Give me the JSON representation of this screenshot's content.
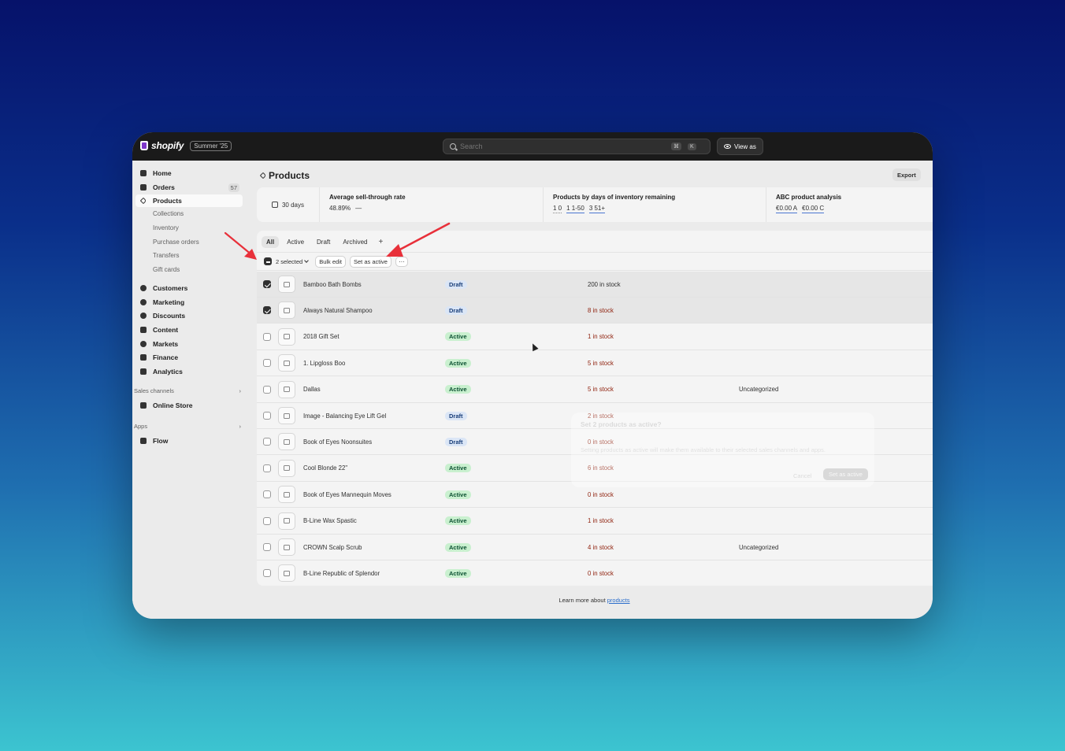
{
  "topbar": {
    "logo": "shopify",
    "edition": "Summer '25",
    "search_placeholder": "Search",
    "shortcut_1": "⌘",
    "shortcut_2": "K",
    "view_as": "View as"
  },
  "sidebar": {
    "home": "Home",
    "orders": "Orders",
    "orders_count": "57",
    "products": "Products",
    "collections": "Collections",
    "inventory": "Inventory",
    "purchase_orders": "Purchase orders",
    "transfers": "Transfers",
    "gift_cards": "Gift cards",
    "customers": "Customers",
    "marketing": "Marketing",
    "discounts": "Discounts",
    "content": "Content",
    "markets": "Markets",
    "finance": "Finance",
    "analytics": "Analytics",
    "sales_channels": "Sales channels",
    "online_store": "Online Store",
    "apps": "Apps",
    "flow": "Flow"
  },
  "page": {
    "title": "Products",
    "export": "Export"
  },
  "stats": {
    "range": "30 days",
    "sell_through_title": "Average sell-through rate",
    "sell_through_value": "48.89%",
    "sell_through_trend": "—",
    "inventory_title": "Products by days of inventory remaining",
    "inv_a": "1 0",
    "inv_b": "1 1-50",
    "inv_c": "3 51+",
    "abc_title": "ABC product analysis",
    "abc_a": "€0.00 A",
    "abc_b": "€0.00 C"
  },
  "tabs": {
    "all": "All",
    "active": "Active",
    "draft": "Draft",
    "archived": "Archived",
    "add": "+"
  },
  "bulk": {
    "selected": "2 selected",
    "bulk_edit": "Bulk edit",
    "set_active": "Set as active",
    "more": "···"
  },
  "products": [
    {
      "name": "Bamboo Bath Bombs",
      "status": "Draft",
      "stock": "200 in stock",
      "type": "",
      "selected": true
    },
    {
      "name": "Always Natural Shampoo",
      "status": "Draft",
      "stock": "8 in stock",
      "type": "",
      "selected": true
    },
    {
      "name": "2018 Gift Set",
      "status": "Active",
      "stock": "1 in stock",
      "type": "",
      "selected": false
    },
    {
      "name": "1. Lipgloss Boo",
      "status": "Active",
      "stock": "5 in stock",
      "type": "",
      "selected": false
    },
    {
      "name": "Dallas",
      "status": "Active",
      "stock": "5 in stock",
      "type": "Uncategorized",
      "selected": false
    },
    {
      "name": "Image - Balancing Eye Lift Gel",
      "status": "Draft",
      "stock": "2 in stock",
      "type": "",
      "selected": false
    },
    {
      "name": "Book of Eyes Noonsuites",
      "status": "Draft",
      "stock": "0 in stock",
      "type": "",
      "selected": false
    },
    {
      "name": "Cool Blonde 22\"",
      "status": "Active",
      "stock": "6 in stock",
      "type": "",
      "selected": false
    },
    {
      "name": "Book of Eyes Mannequin Moves",
      "status": "Active",
      "stock": "0 in stock",
      "type": "",
      "selected": false
    },
    {
      "name": "B-Line Wax Spastic",
      "status": "Active",
      "stock": "1 in stock",
      "type": "",
      "selected": false
    },
    {
      "name": "CROWN Scalp Scrub",
      "status": "Active",
      "stock": "4 in stock",
      "type": "Uncategorized",
      "selected": false
    },
    {
      "name": "B-Line Republic of Splendor",
      "status": "Active",
      "stock": "0 in stock",
      "type": "",
      "selected": false
    }
  ],
  "ghost_dialog": {
    "title": "Set 2 products as active?",
    "body": "Setting products as active will make them available to their selected sales channels and apps.",
    "cancel": "Cancel",
    "confirm": "Set as active"
  },
  "footer": {
    "prefix": "Learn more about",
    "link": "products"
  },
  "colors": {
    "annotation_arrow": "#e8303a",
    "draft_badge": "#dbe6f6",
    "active_badge": "#c9f0cf",
    "stock_low": "#8e1f0b"
  }
}
